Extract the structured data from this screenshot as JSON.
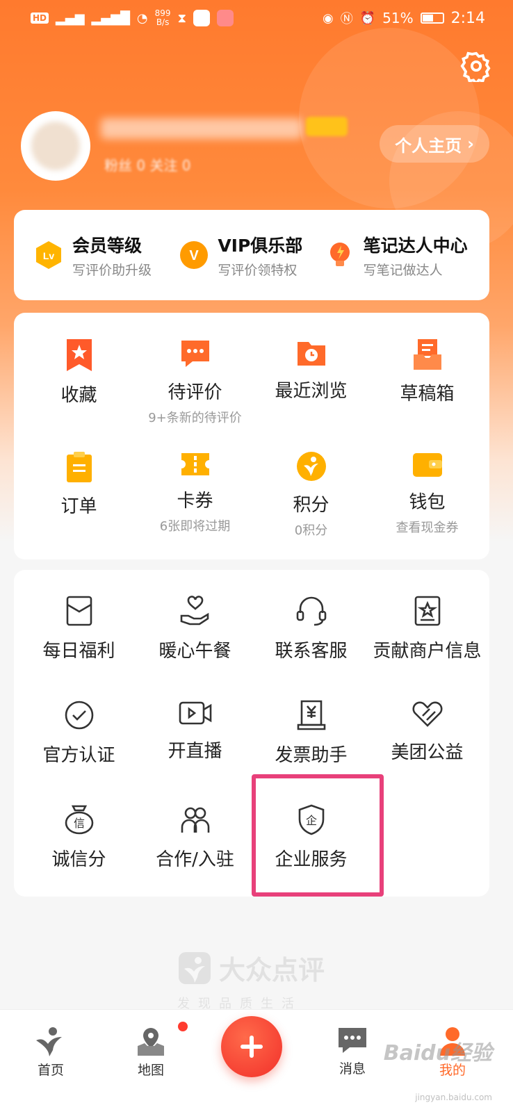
{
  "status_bar": {
    "hd": "HD",
    "net_speed": "899",
    "net_unit": "B/s",
    "battery": "51%",
    "time": "2:14"
  },
  "profile": {
    "stats_text": "粉丝 0   关注 0",
    "home_button": "个人主页"
  },
  "member": [
    {
      "title": "会员等级",
      "subtitle": "写评价助升级",
      "icon": "lv-badge-icon",
      "color": "#ffb400"
    },
    {
      "title": "VIP俱乐部",
      "subtitle": "写评价领特权",
      "icon": "vip-icon",
      "color": "#ff9b00"
    },
    {
      "title": "笔记达人中心",
      "subtitle": "写笔记做达人",
      "icon": "bulb-icon",
      "color": "#ff6a2a"
    }
  ],
  "grid": [
    {
      "label": "收藏",
      "sub": "",
      "icon": "star-bookmark-icon"
    },
    {
      "label": "待评价",
      "sub": "9+条新的待评价",
      "icon": "comment-icon"
    },
    {
      "label": "最近浏览",
      "sub": "",
      "icon": "history-folder-icon"
    },
    {
      "label": "草稿箱",
      "sub": "",
      "icon": "draft-box-icon"
    },
    {
      "label": "订单",
      "sub": "",
      "icon": "order-icon"
    },
    {
      "label": "卡券",
      "sub": "6张即将过期",
      "icon": "coupon-icon"
    },
    {
      "label": "积分",
      "sub": "0积分",
      "icon": "points-icon"
    },
    {
      "label": "钱包",
      "sub": "查看现金券",
      "icon": "wallet-icon"
    }
  ],
  "tools": [
    {
      "label": "每日福利",
      "icon": "red-envelope-icon"
    },
    {
      "label": "暖心午餐",
      "icon": "heart-hand-icon"
    },
    {
      "label": "联系客服",
      "icon": "headset-icon"
    },
    {
      "label": "贡献商户信息",
      "icon": "shop-star-icon"
    },
    {
      "label": "官方认证",
      "icon": "check-circle-icon"
    },
    {
      "label": "开直播",
      "icon": "video-icon"
    },
    {
      "label": "发票助手",
      "icon": "invoice-icon"
    },
    {
      "label": "美团公益",
      "icon": "charity-heart-icon"
    },
    {
      "label": "诚信分",
      "icon": "credit-pot-icon"
    },
    {
      "label": "合作/入驻",
      "icon": "partners-icon"
    },
    {
      "label": "企业服务",
      "icon": "enterprise-shield-icon"
    }
  ],
  "brand": {
    "name": "大众点评",
    "slogan": "发现品质生活"
  },
  "tabbar": [
    {
      "label": "首页",
      "icon": "home-dianping-icon"
    },
    {
      "label": "地图",
      "icon": "map-pin-icon"
    },
    {
      "label": "消息",
      "icon": "message-icon"
    },
    {
      "label": "我的",
      "icon": "profile-icon"
    }
  ],
  "watermark": {
    "text": "Baidu经验",
    "sub": "jingyan.baidu.com"
  },
  "colors": {
    "accent": "#ff7a2e",
    "highlight": "#e8407a",
    "fab": "#f2302a"
  }
}
